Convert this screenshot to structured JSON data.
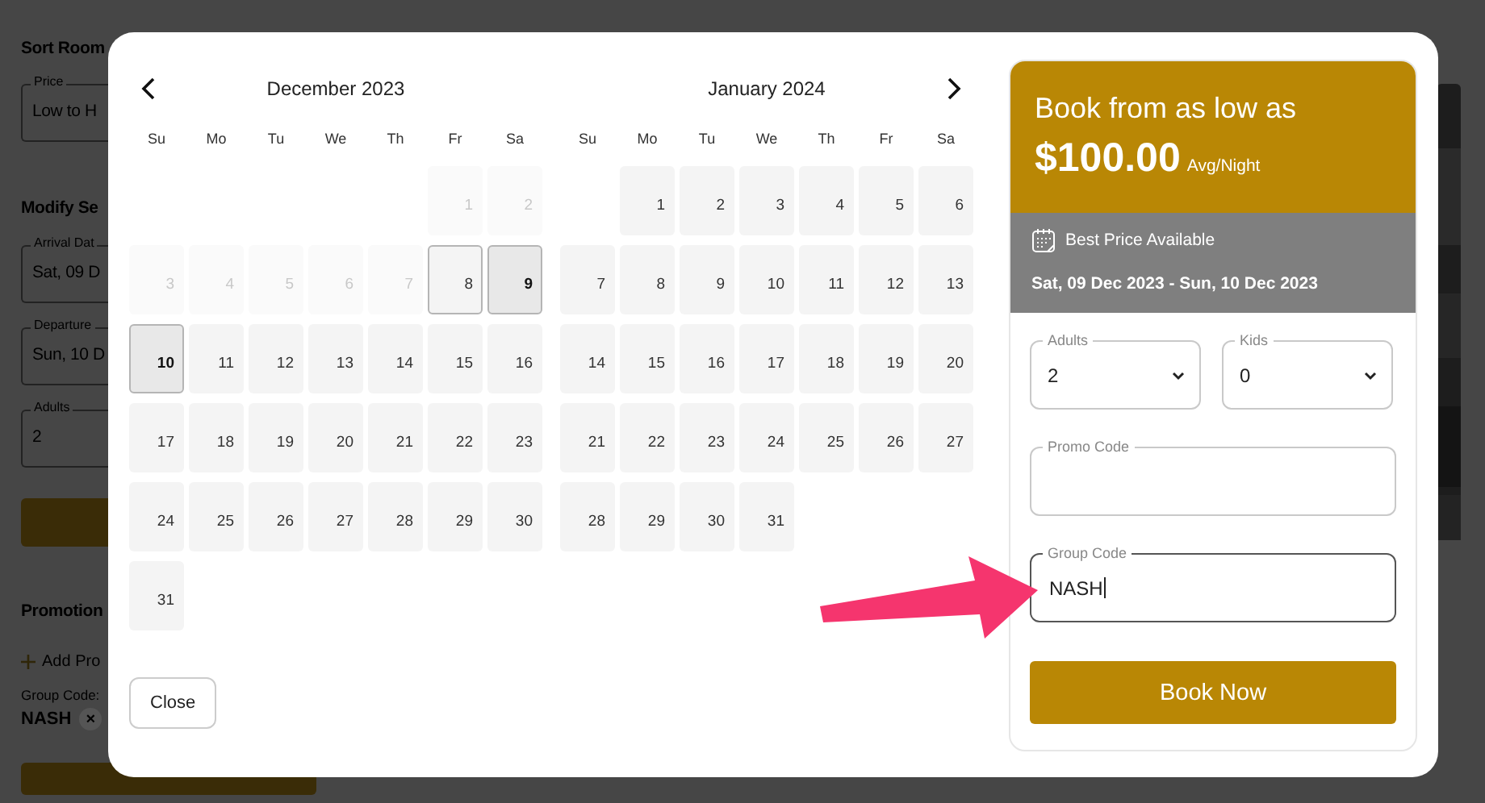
{
  "background_page": {
    "sort_heading": "Sort Room",
    "sort_field": {
      "label": "Price",
      "value": "Low to H"
    },
    "modify_heading": "Modify Se",
    "search_fields": [
      {
        "label": "Arrival Dat",
        "value": "Sat, 09 D"
      },
      {
        "label": "Departure",
        "value": "Sun, 10 D"
      },
      {
        "label": "Adults",
        "value": "2"
      }
    ],
    "promotions_heading": "Promotion",
    "add_promo_link": "Add Pro",
    "group_code_label": "Group Code:",
    "group_code_chip": {
      "text": "NASH",
      "remove": "×"
    }
  },
  "date_picker": {
    "months": [
      {
        "title": "December 2023",
        "weekdays": [
          "Su",
          "Mo",
          "Tu",
          "We",
          "Th",
          "Fr",
          "Sa"
        ],
        "weeks": [
          [
            {
              "kind": "blank"
            },
            {
              "kind": "blank"
            },
            {
              "kind": "blank"
            },
            {
              "kind": "blank"
            },
            {
              "kind": "blank"
            },
            {
              "kind": "day",
              "label": "1",
              "disabled": true,
              "selected": false,
              "outlined": false
            },
            {
              "kind": "day",
              "label": "2",
              "disabled": true,
              "selected": false,
              "outlined": false
            }
          ],
          [
            {
              "kind": "day",
              "label": "3",
              "disabled": true,
              "selected": false,
              "outlined": false
            },
            {
              "kind": "day",
              "label": "4",
              "disabled": true,
              "selected": false,
              "outlined": false
            },
            {
              "kind": "day",
              "label": "5",
              "disabled": true,
              "selected": false,
              "outlined": false
            },
            {
              "kind": "day",
              "label": "6",
              "disabled": true,
              "selected": false,
              "outlined": false
            },
            {
              "kind": "day",
              "label": "7",
              "disabled": true,
              "selected": false,
              "outlined": false
            },
            {
              "kind": "day",
              "label": "8",
              "disabled": false,
              "selected": false,
              "outlined": true
            },
            {
              "kind": "day",
              "label": "9",
              "disabled": false,
              "selected": true,
              "outlined": false
            }
          ],
          [
            {
              "kind": "day",
              "label": "10",
              "disabled": false,
              "selected": true,
              "outlined": false
            },
            {
              "kind": "day",
              "label": "11",
              "disabled": false,
              "selected": false,
              "outlined": false
            },
            {
              "kind": "day",
              "label": "12",
              "disabled": false,
              "selected": false,
              "outlined": false
            },
            {
              "kind": "day",
              "label": "13",
              "disabled": false,
              "selected": false,
              "outlined": false
            },
            {
              "kind": "day",
              "label": "14",
              "disabled": false,
              "selected": false,
              "outlined": false
            },
            {
              "kind": "day",
              "label": "15",
              "disabled": false,
              "selected": false,
              "outlined": false
            },
            {
              "kind": "day",
              "label": "16",
              "disabled": false,
              "selected": false,
              "outlined": false
            }
          ],
          [
            {
              "kind": "day",
              "label": "17",
              "disabled": false,
              "selected": false,
              "outlined": false
            },
            {
              "kind": "day",
              "label": "18",
              "disabled": false,
              "selected": false,
              "outlined": false
            },
            {
              "kind": "day",
              "label": "19",
              "disabled": false,
              "selected": false,
              "outlined": false
            },
            {
              "kind": "day",
              "label": "20",
              "disabled": false,
              "selected": false,
              "outlined": false
            },
            {
              "kind": "day",
              "label": "21",
              "disabled": false,
              "selected": false,
              "outlined": false
            },
            {
              "kind": "day",
              "label": "22",
              "disabled": false,
              "selected": false,
              "outlined": false
            },
            {
              "kind": "day",
              "label": "23",
              "disabled": false,
              "selected": false,
              "outlined": false
            }
          ],
          [
            {
              "kind": "day",
              "label": "24",
              "disabled": false,
              "selected": false,
              "outlined": false
            },
            {
              "kind": "day",
              "label": "25",
              "disabled": false,
              "selected": false,
              "outlined": false
            },
            {
              "kind": "day",
              "label": "26",
              "disabled": false,
              "selected": false,
              "outlined": false
            },
            {
              "kind": "day",
              "label": "27",
              "disabled": false,
              "selected": false,
              "outlined": false
            },
            {
              "kind": "day",
              "label": "28",
              "disabled": false,
              "selected": false,
              "outlined": false
            },
            {
              "kind": "day",
              "label": "29",
              "disabled": false,
              "selected": false,
              "outlined": false
            },
            {
              "kind": "day",
              "label": "30",
              "disabled": false,
              "selected": false,
              "outlined": false
            }
          ],
          [
            {
              "kind": "day",
              "label": "31",
              "disabled": false,
              "selected": false,
              "outlined": false
            }
          ]
        ]
      },
      {
        "title": "January 2024",
        "weekdays": [
          "Su",
          "Mo",
          "Tu",
          "We",
          "Th",
          "Fr",
          "Sa"
        ],
        "weeks": [
          [
            {
              "kind": "blank"
            },
            {
              "kind": "day",
              "label": "1",
              "disabled": false,
              "selected": false,
              "outlined": false
            },
            {
              "kind": "day",
              "label": "2",
              "disabled": false,
              "selected": false,
              "outlined": false
            },
            {
              "kind": "day",
              "label": "3",
              "disabled": false,
              "selected": false,
              "outlined": false
            },
            {
              "kind": "day",
              "label": "4",
              "disabled": false,
              "selected": false,
              "outlined": false
            },
            {
              "kind": "day",
              "label": "5",
              "disabled": false,
              "selected": false,
              "outlined": false
            },
            {
              "kind": "day",
              "label": "6",
              "disabled": false,
              "selected": false,
              "outlined": false
            }
          ],
          [
            {
              "kind": "day",
              "label": "7",
              "disabled": false,
              "selected": false,
              "outlined": false
            },
            {
              "kind": "day",
              "label": "8",
              "disabled": false,
              "selected": false,
              "outlined": false
            },
            {
              "kind": "day",
              "label": "9",
              "disabled": false,
              "selected": false,
              "outlined": false
            },
            {
              "kind": "day",
              "label": "10",
              "disabled": false,
              "selected": false,
              "outlined": false
            },
            {
              "kind": "day",
              "label": "11",
              "disabled": false,
              "selected": false,
              "outlined": false
            },
            {
              "kind": "day",
              "label": "12",
              "disabled": false,
              "selected": false,
              "outlined": false
            },
            {
              "kind": "day",
              "label": "13",
              "disabled": false,
              "selected": false,
              "outlined": false
            }
          ],
          [
            {
              "kind": "day",
              "label": "14",
              "disabled": false,
              "selected": false,
              "outlined": false
            },
            {
              "kind": "day",
              "label": "15",
              "disabled": false,
              "selected": false,
              "outlined": false
            },
            {
              "kind": "day",
              "label": "16",
              "disabled": false,
              "selected": false,
              "outlined": false
            },
            {
              "kind": "day",
              "label": "17",
              "disabled": false,
              "selected": false,
              "outlined": false
            },
            {
              "kind": "day",
              "label": "18",
              "disabled": false,
              "selected": false,
              "outlined": false
            },
            {
              "kind": "day",
              "label": "19",
              "disabled": false,
              "selected": false,
              "outlined": false
            },
            {
              "kind": "day",
              "label": "20",
              "disabled": false,
              "selected": false,
              "outlined": false
            }
          ],
          [
            {
              "kind": "day",
              "label": "21",
              "disabled": false,
              "selected": false,
              "outlined": false
            },
            {
              "kind": "day",
              "label": "22",
              "disabled": false,
              "selected": false,
              "outlined": false
            },
            {
              "kind": "day",
              "label": "23",
              "disabled": false,
              "selected": false,
              "outlined": false
            },
            {
              "kind": "day",
              "label": "24",
              "disabled": false,
              "selected": false,
              "outlined": false
            },
            {
              "kind": "day",
              "label": "25",
              "disabled": false,
              "selected": false,
              "outlined": false
            },
            {
              "kind": "day",
              "label": "26",
              "disabled": false,
              "selected": false,
              "outlined": false
            },
            {
              "kind": "day",
              "label": "27",
              "disabled": false,
              "selected": false,
              "outlined": false
            }
          ],
          [
            {
              "kind": "day",
              "label": "28",
              "disabled": false,
              "selected": false,
              "outlined": false
            },
            {
              "kind": "day",
              "label": "29",
              "disabled": false,
              "selected": false,
              "outlined": false
            },
            {
              "kind": "day",
              "label": "30",
              "disabled": false,
              "selected": false,
              "outlined": false
            },
            {
              "kind": "day",
              "label": "31",
              "disabled": false,
              "selected": false,
              "outlined": false
            }
          ]
        ]
      }
    ],
    "close_button": "Close"
  },
  "booking_card": {
    "heading": "Book from as low as",
    "price": "$100.00",
    "price_unit": "Avg/Night",
    "badge": "Best Price Available",
    "dates": "Sat, 09 Dec 2023 - Sun, 10 Dec 2023",
    "selects": [
      {
        "label": "Adults",
        "value": "2"
      },
      {
        "label": "Kids",
        "value": "0"
      }
    ],
    "text_fields": [
      {
        "label": "Promo Code",
        "focused": false
      },
      {
        "label": "Group Code",
        "value": "NASH",
        "focused": true
      }
    ],
    "book_button": "Book Now"
  }
}
